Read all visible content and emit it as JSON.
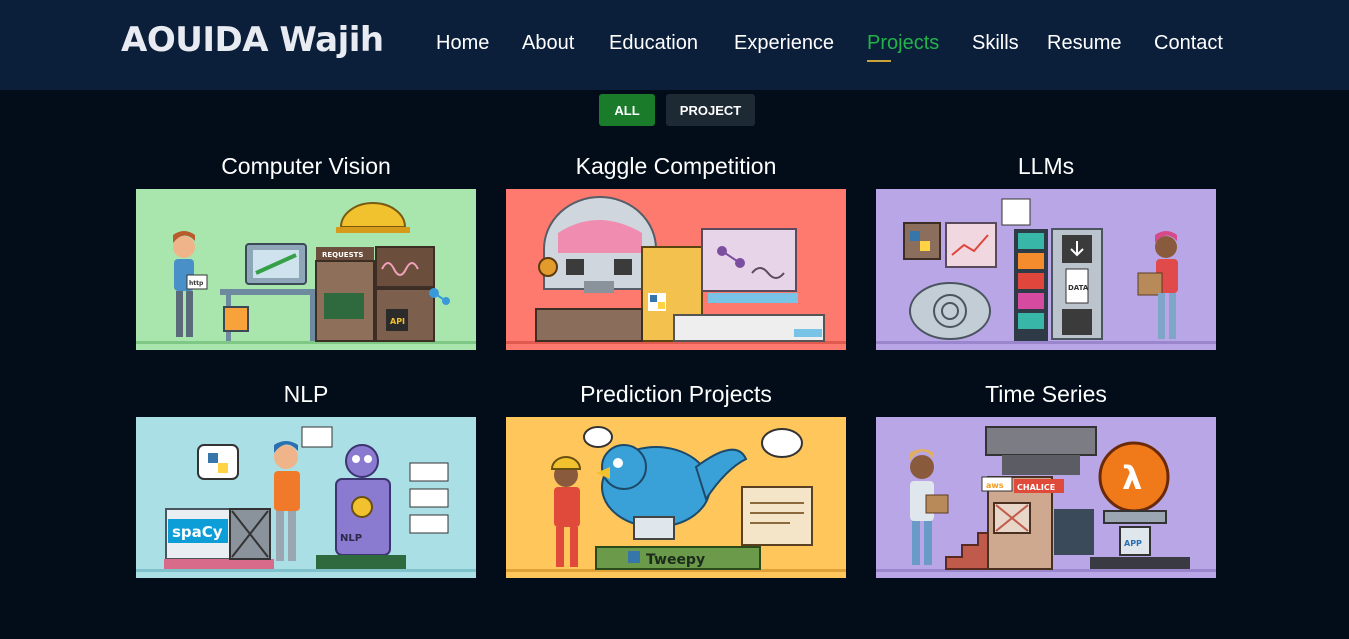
{
  "header": {
    "logo": "AOUIDA Wajih",
    "nav": [
      {
        "label": "Home",
        "active": false
      },
      {
        "label": "About",
        "active": false
      },
      {
        "label": "Education",
        "active": false
      },
      {
        "label": "Experience",
        "active": false
      },
      {
        "label": "Projects",
        "active": true
      },
      {
        "label": "Skills",
        "active": false
      },
      {
        "label": "Resume",
        "active": false
      },
      {
        "label": "Contact",
        "active": false
      }
    ]
  },
  "filters": {
    "all_label": "ALL",
    "project_label": "PROJECT",
    "selected": "ALL"
  },
  "projects": [
    {
      "title": "Computer Vision",
      "bg": "#a9e6ad",
      "labels": {
        "sign": "REQUESTS",
        "chip": "API",
        "doc": "http"
      }
    },
    {
      "title": "Kaggle Competition",
      "bg": "#ff7a6e",
      "labels": {}
    },
    {
      "title": "LLMs",
      "bg": "#b9a6e6",
      "labels": {
        "data": "DATA"
      }
    },
    {
      "title": "NLP",
      "bg": "#a9dfe5",
      "labels": {
        "brand": "spaCy",
        "robot": "NLP"
      }
    },
    {
      "title": "Prediction Projects",
      "bg": "#ffc65c",
      "labels": {
        "brand": "Tweepy"
      }
    },
    {
      "title": "Time Series",
      "bg": "#b9a6e6",
      "labels": {
        "aws": "aws",
        "badge": "CHALICE",
        "lambda": "λ",
        "app": "APP"
      }
    }
  ],
  "colors": {
    "page_bg": "#020d19",
    "header_bg": "#0b1f3a",
    "active_nav": "#23b24b",
    "underline": "#c8a23a",
    "filter_active": "#1a7b2b",
    "filter_inactive": "#1e2a33"
  }
}
